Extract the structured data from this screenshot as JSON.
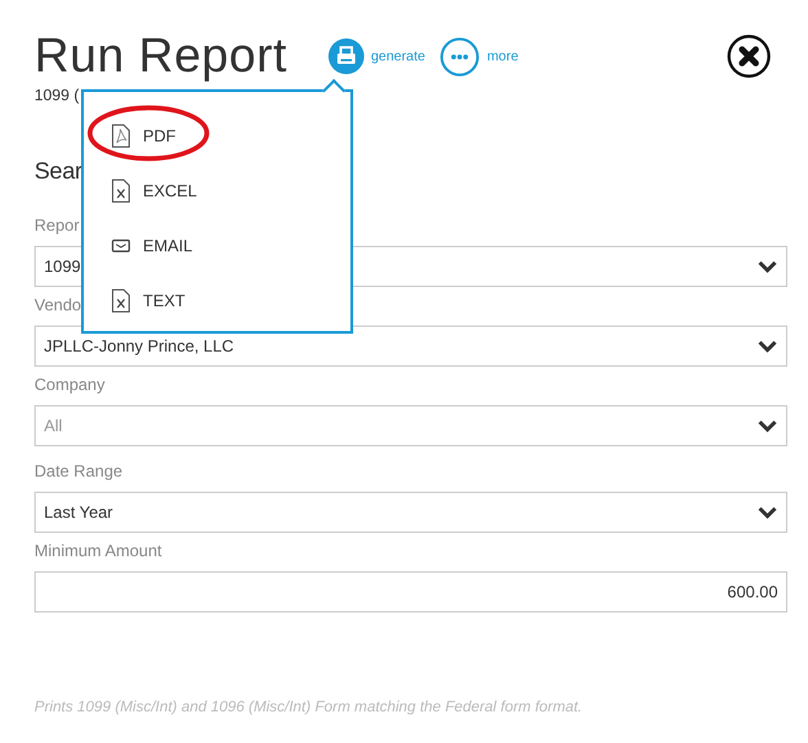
{
  "title": "Run Report",
  "actions": [
    {
      "kind": "generate",
      "label": "generate"
    },
    {
      "kind": "more",
      "label": "more"
    }
  ],
  "subtitle": "1099 (",
  "section_heading": "Sear",
  "fields": [
    {
      "label": "Repor",
      "value": "1099",
      "kind": "select",
      "disabled": false
    },
    {
      "label": "Vendo",
      "value": "JPLLC-Jonny Prince, LLC",
      "kind": "select",
      "disabled": false
    },
    {
      "label": "Company",
      "value": "All",
      "kind": "select",
      "disabled": true
    },
    {
      "label": "Date Range",
      "value": "Last Year",
      "kind": "select",
      "disabled": false
    },
    {
      "label": "Minimum Amount",
      "value": "600.00",
      "kind": "input",
      "disabled": false
    }
  ],
  "generate_menu": [
    {
      "label": "PDF",
      "kind": "pdf",
      "circled": true
    },
    {
      "label": "EXCEL",
      "kind": "excel",
      "circled": false
    },
    {
      "label": "EMAIL",
      "kind": "email",
      "circled": false
    },
    {
      "label": "TEXT",
      "kind": "text",
      "circled": false
    }
  ],
  "footer_note": "Prints 1099 (Misc/Int) and 1096 (Misc/Int) Form matching the Federal form format."
}
